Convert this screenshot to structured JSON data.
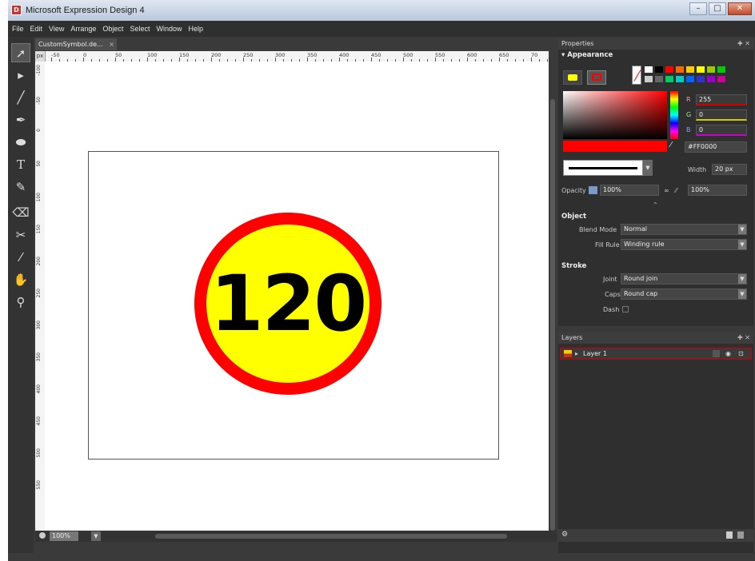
{
  "window": {
    "title": "Microsoft Expression Design 4",
    "app_icon": "D",
    "controls": [
      "–",
      "□",
      "✕"
    ]
  },
  "menu": [
    "File",
    "Edit",
    "View",
    "Arrange",
    "Object",
    "Select",
    "Window",
    "Help"
  ],
  "document": {
    "tab_label": "CustomSymbol.de...",
    "tab_close": "×",
    "ruler_unit": "px",
    "ruler_h_labels": [
      "-50",
      "0",
      "50",
      "100",
      "150",
      "200",
      "250",
      "300",
      "350",
      "400",
      "450",
      "500",
      "550",
      "600",
      "650",
      "70"
    ],
    "ruler_v_labels": [
      "-100",
      "-50",
      "0",
      "50",
      "100",
      "150",
      "200",
      "250",
      "300",
      "350",
      "400",
      "450",
      "500",
      "550"
    ],
    "sign_text": "120",
    "colors": {
      "ring": "#FF0000",
      "fill": "#FFFF00",
      "text": "#000000"
    }
  },
  "status": {
    "zoom": "100%"
  },
  "properties": {
    "panel_title": "Properties",
    "appearance_label": "Appearance",
    "rgb": {
      "r_label": "R",
      "r": "255",
      "g_label": "G",
      "g": "0",
      "b_label": "B",
      "b": "0"
    },
    "hex": "#FF0000",
    "width_label": "Width",
    "width_value": "20 px",
    "opacity_label": "Opacity",
    "opacity_value": "100%",
    "opacity2_value": "100%",
    "object_label": "Object",
    "blend_label": "Blend Mode",
    "blend_value": "Normal",
    "fillrule_label": "Fill Rule",
    "fillrule_value": "Winding rule",
    "stroke_label": "Stroke",
    "joint_label": "Joint",
    "joint_value": "Round join",
    "caps_label": "Caps",
    "caps_value": "Round cap",
    "dash_label": "Dash"
  },
  "layers": {
    "panel_title": "Layers",
    "layer_name": "Layer 1"
  },
  "swatch_colors": [
    "#ffffff",
    "#000000",
    "#ff0000",
    "#ff6600",
    "#ffcc00",
    "#ffff00",
    "#99cc00",
    "#00cc00",
    "#cccccc",
    "#666666",
    "#00cc66",
    "#00cccc",
    "#0066ff",
    "#3333cc",
    "#9900cc",
    "#cc0099"
  ]
}
